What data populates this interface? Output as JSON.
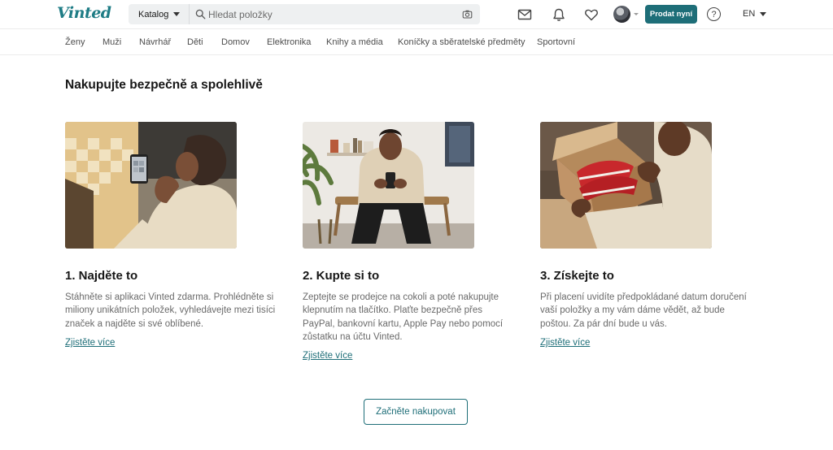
{
  "header": {
    "logo": "Vinted",
    "catalog_label": "Katalog",
    "search_placeholder": "Hledat položky",
    "sell_label": "Prodat nyní",
    "help_label": "?",
    "lang_label": "EN",
    "icons": [
      "mail-icon",
      "bell-icon",
      "heart-icon",
      "camera-icon",
      "search-icon"
    ]
  },
  "categories": [
    "Ženy",
    "Muži",
    "Návrhář",
    "Děti",
    "Domov",
    "Elektronika",
    "Knihy a média",
    "Koníčky a sběratelské předměty",
    "Sportovní"
  ],
  "main": {
    "title": "Nakupujte bezpečně a spolehlivě",
    "steps": [
      {
        "title": "1. Najděte to",
        "description": "Stáhněte si aplikaci Vinted zdarma. Prohlédněte si miliony unikátních položek, vyhledávejte mezi tisíci značek a najděte si své oblíbené.",
        "link": "Zjistěte více"
      },
      {
        "title": "2. Kupte si to",
        "description": "Zeptejte se prodejce na cokoli a poté nakupujte klepnutím na tlačítko. Plaťte bezpečně přes PayPal, bankovní kartu, Apple Pay nebo pomocí zůstatku na účtu Vinted.",
        "link": "Zjistěte více"
      },
      {
        "title": "3. Získejte to",
        "description": "Při placení uvidíte předpokládané datum doručení vaší položky a my vám dáme vědět, až bude poštou. Za pár dní bude u vás.",
        "link": "Zjistěte více"
      }
    ],
    "cta_label": "Začněte nakupovat"
  },
  "colors": {
    "brand": "#1e7c85",
    "button": "#1e6e78"
  }
}
